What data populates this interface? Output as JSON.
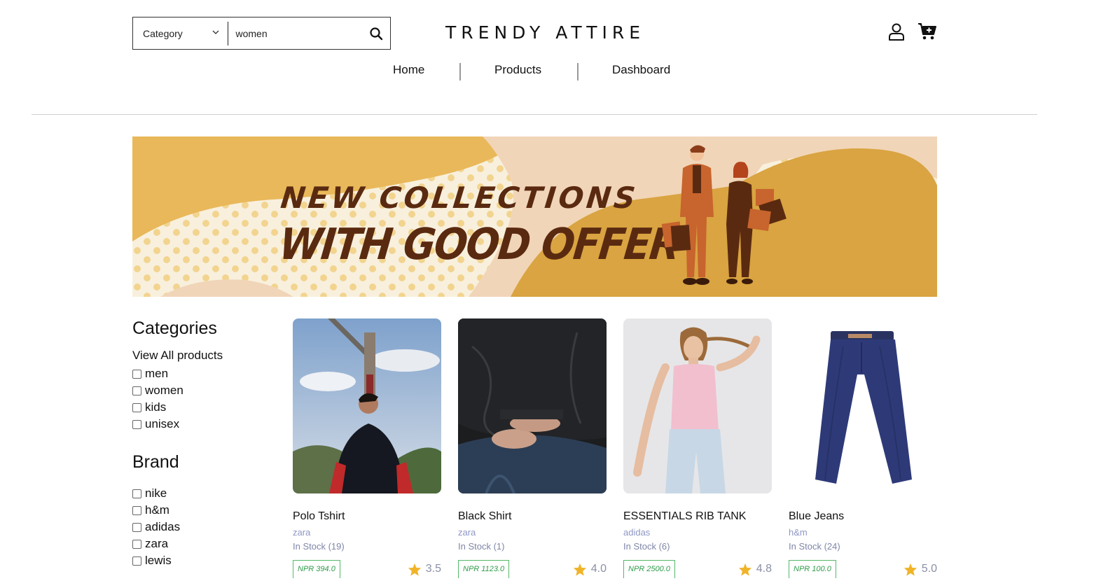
{
  "header": {
    "category_label": "Category",
    "search_value": "women",
    "brand_title": "TRENDY ATTIRE",
    "icons": [
      "user-icon",
      "cart-icon",
      "search-icon",
      "chevron-down-icon"
    ]
  },
  "nav": {
    "items": [
      {
        "label": "Home"
      },
      {
        "label": "Products"
      },
      {
        "label": "Dashboard"
      }
    ]
  },
  "banner": {
    "line1": "NEW COLLECTIONS",
    "line2": "WITH GOOD OFFER",
    "colors": {
      "mustard": "#d9a441",
      "cream": "#f8f0dd",
      "peach": "#f1d5b8",
      "text": "#5a2a10"
    }
  },
  "sidebar": {
    "categories_heading": "Categories",
    "view_all": "View All products",
    "categories": [
      {
        "label": "men"
      },
      {
        "label": "women"
      },
      {
        "label": "kids"
      },
      {
        "label": "unisex"
      }
    ],
    "brand_heading": "Brand",
    "brands": [
      {
        "label": "nike"
      },
      {
        "label": "h&m"
      },
      {
        "label": "adidas"
      },
      {
        "label": "zara"
      },
      {
        "label": "lewis"
      }
    ]
  },
  "products": [
    {
      "name": "Polo Tshirt",
      "brand": "zara",
      "stock": "In Stock (19)",
      "price": "NPR 394.0",
      "rating": "3.5"
    },
    {
      "name": "Black Shirt",
      "brand": "zara",
      "stock": "In Stock (1)",
      "price": "NPR 1123.0",
      "rating": "4.0"
    },
    {
      "name": "ESSENTIALS RIB TANK",
      "brand": "adidas",
      "stock": "In Stock (6)",
      "price": "NPR 2500.0",
      "rating": "4.8"
    },
    {
      "name": "Blue Jeans",
      "brand": "h&m",
      "stock": "In Stock (24)",
      "price": "NPR 100.0",
      "rating": "5.0"
    }
  ],
  "colors": {
    "price_green": "#2f9c4a",
    "star": "#f0b429",
    "meta_text": "#8f97c4"
  }
}
